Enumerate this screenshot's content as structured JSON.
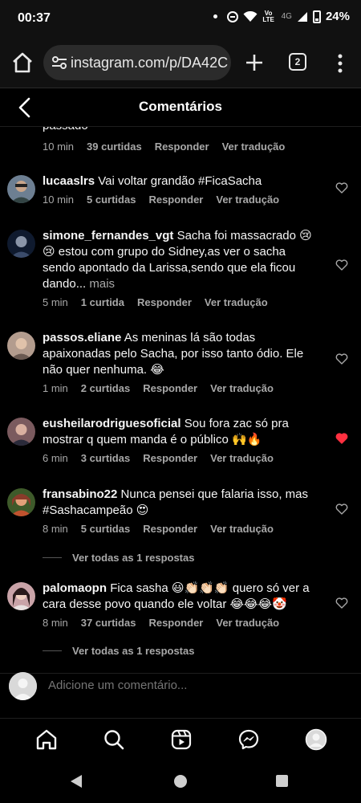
{
  "status_bar": {
    "time": "00:37",
    "volte": "Vo LTE",
    "network": "4G",
    "battery": "24%"
  },
  "browser": {
    "url": "instagram.com/p/DA42C",
    "tab_count": "2"
  },
  "header": {
    "title": "Comentários"
  },
  "comments": {
    "partial_top": {
      "text_tail": "passado",
      "time": "10 min",
      "likes": "39 curtidas",
      "reply": "Responder",
      "translate": "Ver tradução"
    },
    "items": [
      {
        "username": "lucaaslrs",
        "text": "Vai voltar grandão #FicaSacha",
        "more": "",
        "time": "10 min",
        "likes": "5 curtidas",
        "reply": "Responder",
        "translate": "Ver tradução",
        "liked": false,
        "avatar_color": "#6d7f92"
      },
      {
        "username": "simone_fernandes_vgt",
        "text": "Sacha foi massacrado 😢 😢 estou com grupo do Sidney,as ver o sacha sendo apontado da Larissa,sendo que ela ficou dando...",
        "more": "mais",
        "time": "5 min",
        "likes": "1 curtida",
        "reply": "Responder",
        "translate": "Ver tradução",
        "liked": false,
        "avatar_color": "#2b3a55"
      },
      {
        "username": "passos.eliane",
        "text": "As meninas lá são todas apaixonadas pelo Sacha, por isso tanto ódio. Ele não quer nenhuma. 😂",
        "more": "",
        "time": "1 min",
        "likes": "2 curtidas",
        "reply": "Responder",
        "translate": "Ver tradução",
        "liked": false,
        "avatar_color": "#b39c8e"
      },
      {
        "username": "eusheilarodriguesoficial",
        "text": "Sou fora zac só pra mostrar q quem manda é o público 🙌🔥",
        "more": "",
        "time": "6 min",
        "likes": "3 curtidas",
        "reply": "Responder",
        "translate": "Ver tradução",
        "liked": true,
        "avatar_color": "#7a5a5e"
      },
      {
        "username": "fransabino22",
        "text": "Nunca pensei que falaria isso, mas #Sashacampeão 😍",
        "more": "",
        "time": "8 min",
        "likes": "5 curtidas",
        "reply": "Responder",
        "translate": "Ver tradução",
        "liked": false,
        "avatar_color": "#8a3b2a",
        "view_replies": "Ver todas as 1 respostas"
      },
      {
        "username": "palomaopn",
        "text": "Fica sasha 😃👏🏻👏🏻👏🏻 quero só ver a cara desse povo quando ele voltar 😂😂😂🤡",
        "more": "",
        "time": "8 min",
        "likes": "37 curtidas",
        "reply": "Responder",
        "translate": "Ver tradução",
        "liked": false,
        "avatar_color": "#c9a3a8",
        "view_replies": "Ver todas as 1 respostas"
      }
    ]
  },
  "add_comment": {
    "placeholder": "Adicione um comentário..."
  },
  "bottom_nav": {
    "items": [
      "home-icon",
      "search-icon",
      "reels-icon",
      "messenger-icon",
      "profile-icon"
    ]
  },
  "colors": {
    "background": "#000000",
    "text_primary": "#f5f5f5",
    "text_secondary": "#a8a8a8",
    "liked_heart": "#ff3040"
  }
}
